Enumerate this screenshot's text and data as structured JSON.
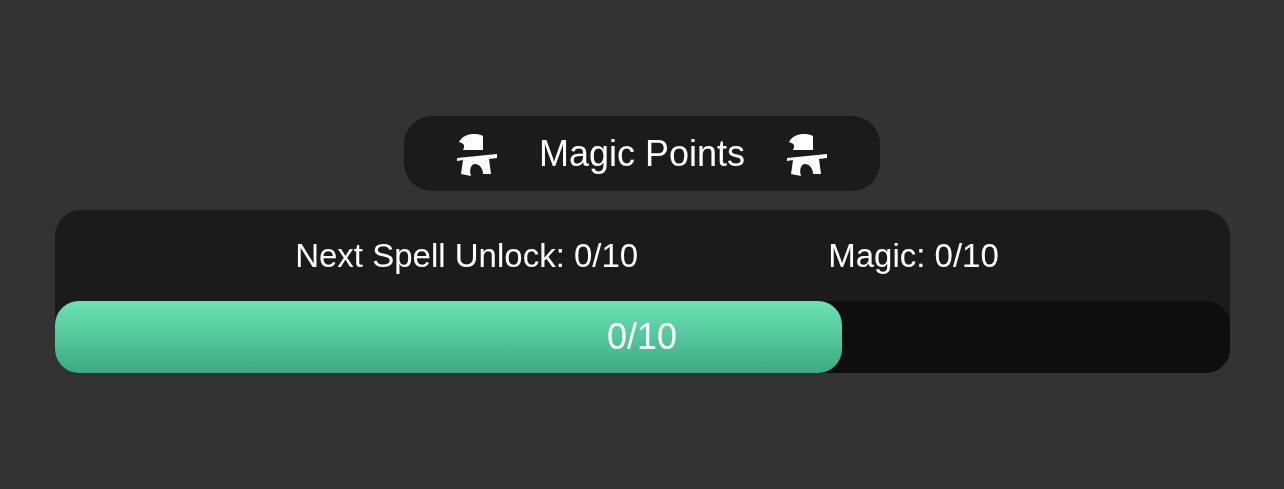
{
  "header": {
    "title": "Magic Points"
  },
  "stats": [
    {
      "label": "Next Spell Unlock: 0/10"
    },
    {
      "label": "Magic: 0/10"
    }
  ],
  "progress": {
    "level": 0.67,
    "reading": "0/10"
  }
}
